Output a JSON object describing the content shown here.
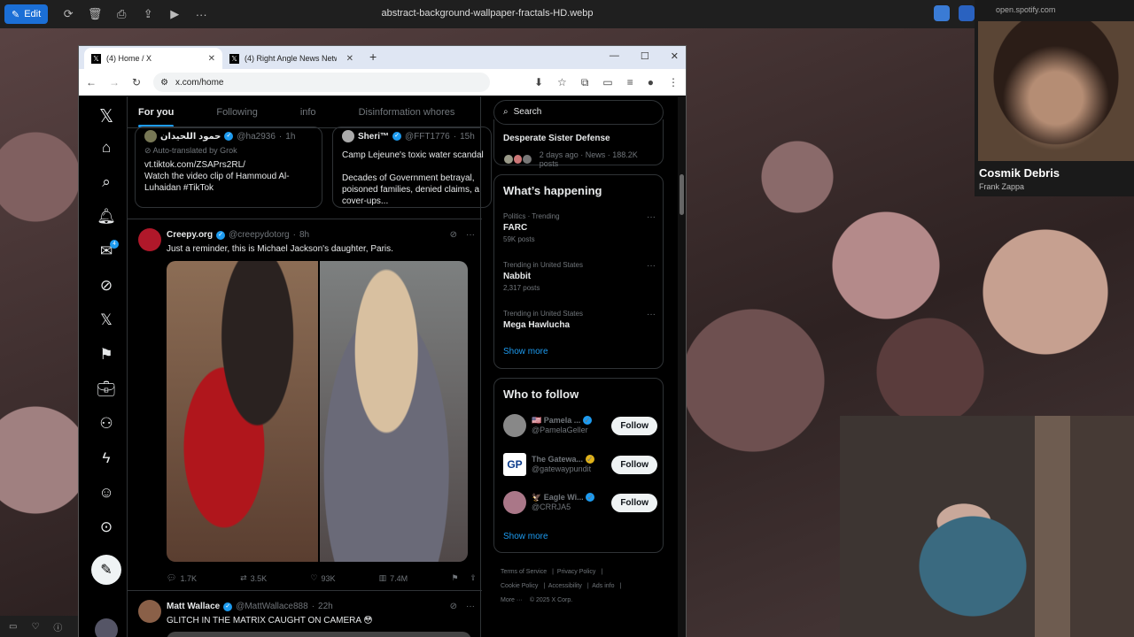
{
  "viewer": {
    "edit_label": "Edit",
    "filename": "abstract-background-wallpaper-fractals-HD.webp"
  },
  "spotify": {
    "url": "open.spotify.com",
    "track": "Cosmik Debris",
    "artist": "Frank Zappa"
  },
  "browser": {
    "tabs": [
      {
        "title": "(4) Home / X"
      },
      {
        "title": "(4) Right Angle News Network"
      }
    ],
    "url": "x.com/home"
  },
  "x": {
    "tabs": [
      "For you",
      "Following",
      "info",
      "Disinformation whores"
    ],
    "messages_badge": "4",
    "quote_cards": [
      {
        "name": "حمود اللحيدان",
        "handle": "@ha2936",
        "time": "1h",
        "grok": "Auto-translated by Grok",
        "lines": [
          "vt.tiktok.com/ZSAPrs2RL/",
          "Watch the video clip of Hammoud Al-",
          "Luhaidan #TikTok"
        ]
      },
      {
        "name": "Sheri™",
        "handle": "@FFT1776",
        "time": "15h",
        "lines": [
          "Camp Lejeune's toxic water scandal",
          "",
          "Decades of Government betrayal,",
          "poisoned families, denied claims, a",
          "cover-ups..."
        ]
      }
    ],
    "posts": [
      {
        "name": "Creepy.org",
        "handle": "@creepydotorg",
        "time": "8h",
        "text": "Just a reminder, this is Michael Jackson's daughter, Paris.",
        "replies": "1.7K",
        "reposts": "3.5K",
        "likes": "93K",
        "views": "7.4M"
      },
      {
        "name": "Matt Wallace",
        "handle": "@MattWallace888",
        "time": "22h",
        "text": "GLITCH IN THE MATRIX CAUGHT ON CAMERA 😳"
      }
    ],
    "search_placeholder": "Search",
    "top_trend": {
      "title": "Desperate Sister Defense",
      "meta": "2 days ago · News · 188.2K posts"
    },
    "whats_happening": {
      "title": "What’s happening",
      "trends": [
        {
          "context": "Politics · Trending",
          "name": "FARC",
          "count": "59K posts"
        },
        {
          "context": "Trending in United States",
          "name": "Nabbit",
          "count": "2,317 posts"
        },
        {
          "context": "Trending in United States",
          "name": "Mega Hawlucha",
          "count": ""
        }
      ],
      "show_more": "Show more"
    },
    "who_to_follow": {
      "title": "Who to follow",
      "accounts": [
        {
          "name": "🇺🇸 Pamela ...",
          "handle": "@PamelaGeller",
          "button": "Follow"
        },
        {
          "name": "The Gatewa...",
          "handle": "@gatewaypundit",
          "button": "Follow",
          "avatar_text": "GP"
        },
        {
          "name": "🦅 Eagle Wi...",
          "handle": "@CRRJA5",
          "button": "Follow"
        }
      ],
      "show_more": "Show more"
    },
    "footer": [
      "Terms of Service",
      "Privacy Policy",
      "Cookie Policy",
      "Accessibility",
      "Ads info",
      "More ···",
      "© 2025 X Corp."
    ]
  },
  "colors": {
    "accent": "#1d9bf0",
    "edit": "#1b6fd6"
  }
}
